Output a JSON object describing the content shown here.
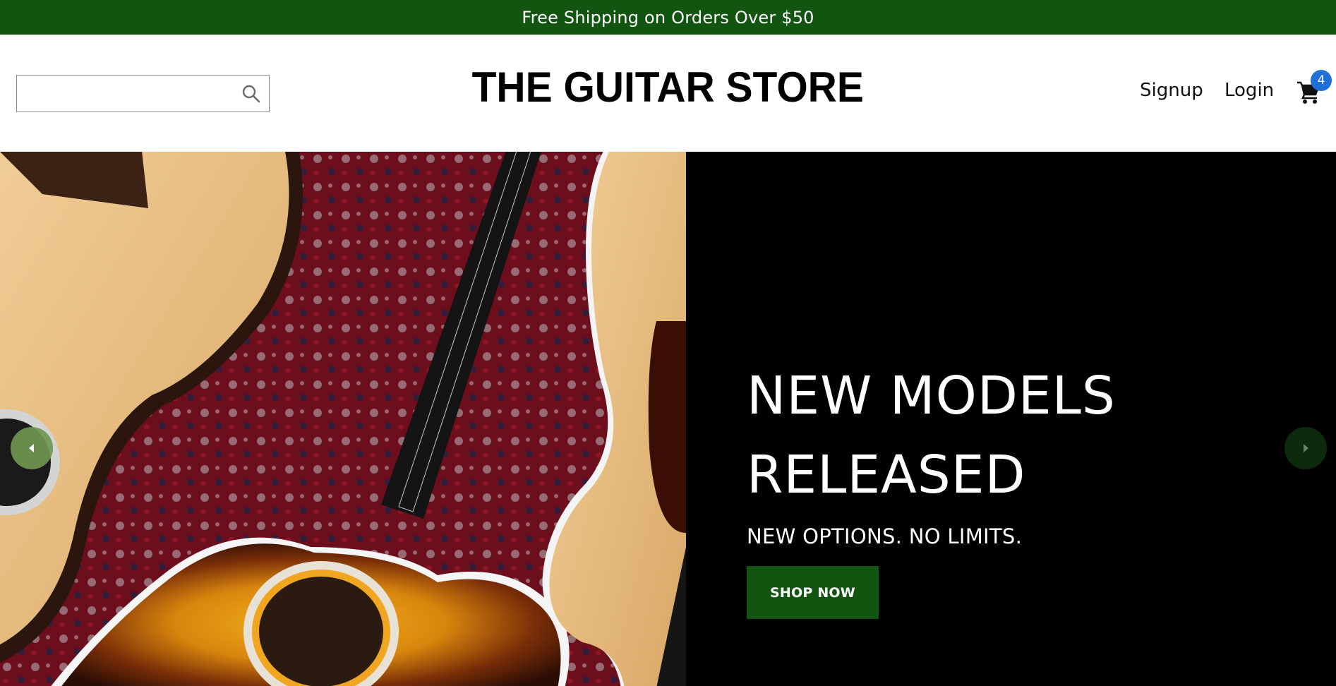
{
  "promo": {
    "text": "Free Shipping on Orders Over $50"
  },
  "header": {
    "search": {
      "value": "",
      "placeholder": ""
    },
    "logo": "THE GUITAR STORE",
    "nav": {
      "signup": "Signup",
      "login": "Login"
    },
    "cart": {
      "count": "4",
      "icon": "cart-icon"
    }
  },
  "hero": {
    "title": "NEW MODELS RELEASED",
    "subtitle": "NEW OPTIONS. NO LIMITS.",
    "cta": "SHOP NOW",
    "image_description_icon": "acoustic-guitars-photo",
    "prev_icon": "chevron-left-icon",
    "next_icon": "chevron-right-icon"
  },
  "colors": {
    "brand_green": "#115511",
    "badge_blue": "#1f6fd8",
    "hero_bg": "#000000"
  }
}
